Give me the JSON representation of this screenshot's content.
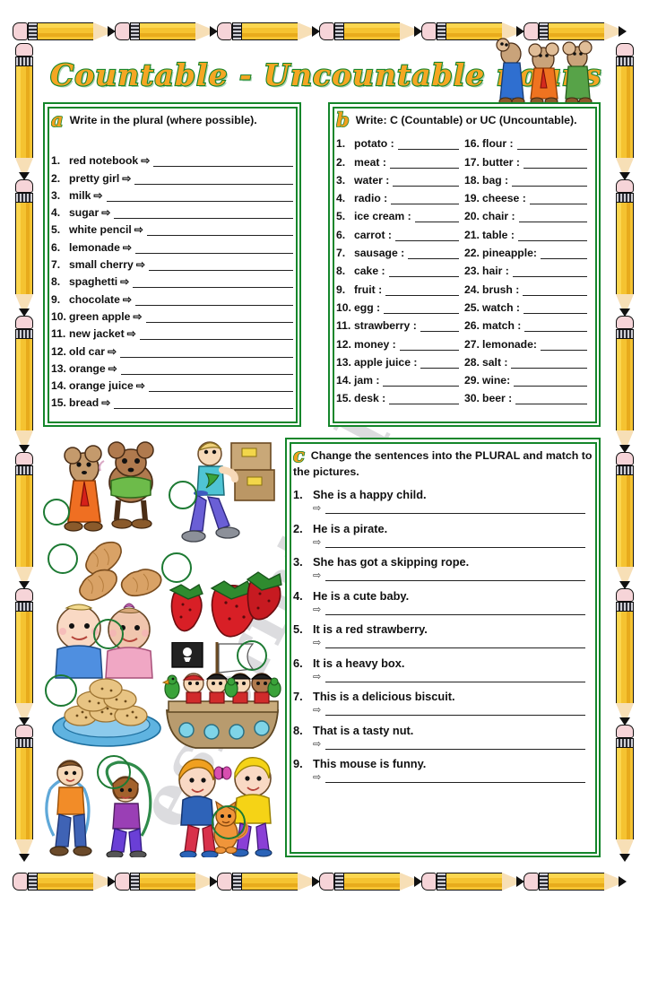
{
  "worksheet": {
    "title": "Countable - Uncountable nouns",
    "watermark": "eslprintables.com"
  },
  "exercise_a": {
    "marker": "a",
    "instruction_pre": "Write in the ",
    "instruction_bold": "plural",
    "instruction_post": " (where possible).",
    "arrow": "⇨",
    "items": [
      {
        "num": "1.",
        "word": "red notebook"
      },
      {
        "num": "2.",
        "word": "pretty girl"
      },
      {
        "num": "3.",
        "word": "milk"
      },
      {
        "num": "4.",
        "word": "sugar"
      },
      {
        "num": "5.",
        "word": "white pencil"
      },
      {
        "num": "6.",
        "word": "lemonade"
      },
      {
        "num": "7.",
        "word": "small cherry"
      },
      {
        "num": "8.",
        "word": "spaghetti"
      },
      {
        "num": "9.",
        "word": "chocolate"
      },
      {
        "num": "10.",
        "word": "green apple"
      },
      {
        "num": "11.",
        "word": "new jacket"
      },
      {
        "num": "12.",
        "word": "old car"
      },
      {
        "num": "13.",
        "word": "orange"
      },
      {
        "num": "14.",
        "word": "orange juice"
      },
      {
        "num": "15.",
        "word": "bread"
      }
    ]
  },
  "exercise_b": {
    "marker": "b",
    "instruction_1": "Write: ",
    "instruction_c": "C",
    "instruction_2": " (Countable) or ",
    "instruction_uc": "UC",
    "instruction_3": " (Uncountable).",
    "column_left": [
      {
        "num": "1.",
        "word": "potato :"
      },
      {
        "num": "2.",
        "word": "meat :"
      },
      {
        "num": "3.",
        "word": "water :"
      },
      {
        "num": "4.",
        "word": "radio :"
      },
      {
        "num": "5.",
        "word": "ice cream :"
      },
      {
        "num": "6.",
        "word": "carrot :"
      },
      {
        "num": "7.",
        "word": "sausage :"
      },
      {
        "num": "8.",
        "word": "cake :"
      },
      {
        "num": "9.",
        "word": "fruit :"
      },
      {
        "num": "10.",
        "word": "egg :"
      },
      {
        "num": "11.",
        "word": "strawberry :"
      },
      {
        "num": "12.",
        "word": "money :"
      },
      {
        "num": "13.",
        "word": "apple juice :"
      },
      {
        "num": "14.",
        "word": "jam :"
      },
      {
        "num": "15.",
        "word": "desk :"
      }
    ],
    "column_right": [
      {
        "num": "16.",
        "word": "flour :"
      },
      {
        "num": "17.",
        "word": "butter :"
      },
      {
        "num": "18.",
        "word": "bag :"
      },
      {
        "num": "19.",
        "word": "cheese :"
      },
      {
        "num": "20.",
        "word": "chair :"
      },
      {
        "num": "21.",
        "word": "table :"
      },
      {
        "num": "22.",
        "word": "pineapple:"
      },
      {
        "num": "23.",
        "word": "hair :"
      },
      {
        "num": "24.",
        "word": "brush :"
      },
      {
        "num": "25.",
        "word": "watch :"
      },
      {
        "num": "26.",
        "word": "match :"
      },
      {
        "num": "27.",
        "word": "lemonade:"
      },
      {
        "num": "28.",
        "word": "salt :"
      },
      {
        "num": "29.",
        "word": "wine:"
      },
      {
        "num": "30.",
        "word": "beer :"
      }
    ]
  },
  "exercise_c": {
    "marker": "c",
    "instruction": "Change the sentences into the PLURAL and match to the pictures.",
    "arrow": "⇨",
    "items": [
      {
        "num": "1.",
        "sentence": "She is a happy child."
      },
      {
        "num": "2.",
        "sentence": "He is a pirate."
      },
      {
        "num": "3.",
        "sentence": "She has got a skipping rope."
      },
      {
        "num": "4.",
        "sentence": "He is a cute baby."
      },
      {
        "num": "5.",
        "sentence": "It is a red strawberry."
      },
      {
        "num": "6.",
        "sentence": "It is a heavy box."
      },
      {
        "num": "7.",
        "sentence": "This is a delicious biscuit."
      },
      {
        "num": "8.",
        "sentence": "That is a tasty nut."
      },
      {
        "num": "9.",
        "sentence": "This mouse is funny."
      }
    ]
  },
  "illustrations": {
    "pictures": [
      {
        "name": "mice",
        "label": "two funny mice"
      },
      {
        "name": "boxes",
        "label": "man carrying heavy boxes"
      },
      {
        "name": "peanuts",
        "label": "tasty nuts"
      },
      {
        "name": "strawberries",
        "label": "red strawberries"
      },
      {
        "name": "babies",
        "label": "cute babies"
      },
      {
        "name": "biscuits",
        "label": "delicious biscuits"
      },
      {
        "name": "pirates",
        "label": "pirates on a ship"
      },
      {
        "name": "skipping",
        "label": "children with skipping ropes"
      },
      {
        "name": "children",
        "label": "happy children"
      }
    ]
  },
  "decor": {
    "pencil_label": "pencil",
    "mascot_label": "three cartoon mice"
  },
  "colors": {
    "frame_green": "#14862b",
    "title_orange": "#f5a623",
    "pencil_yellow": "#f5c331",
    "eraser_pink": "#f6d4d8"
  }
}
